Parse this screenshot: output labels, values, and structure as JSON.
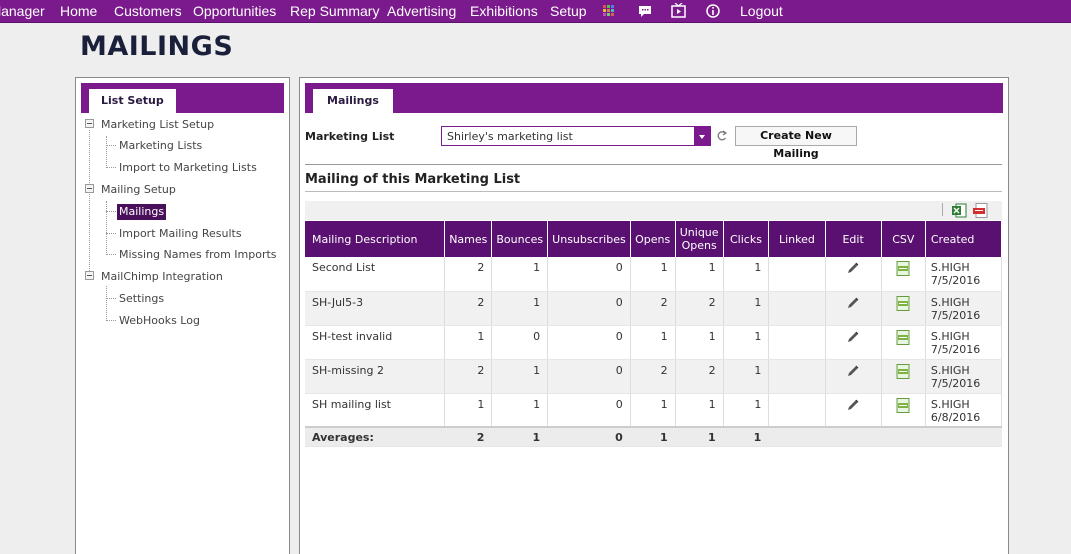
{
  "nav": {
    "items": [
      "lanager",
      "Home",
      "Customers",
      "Opportunities",
      "Rep Summary",
      "Advertising",
      "Exhibitions",
      "Setup"
    ],
    "logout": "Logout",
    "icons": [
      "apps-grid-icon",
      "chat-icon",
      "video-icon",
      "info-icon"
    ],
    "accent": "#7b1a8c"
  },
  "page_title": "MAILINGS",
  "left": {
    "tab": "List Setup",
    "tree": [
      {
        "label": "Marketing List Setup",
        "children": [
          "Marketing Lists",
          "Import to Marketing Lists"
        ]
      },
      {
        "label": "Mailing Setup",
        "children": [
          "Mailings",
          "Import Mailing Results",
          "Missing Names from Imports"
        ]
      },
      {
        "label": "MailChimp Integration",
        "children": [
          "Settings",
          "WebHooks Log"
        ]
      }
    ],
    "selected": "Mailings"
  },
  "right": {
    "tab": "Mailings",
    "list_label": "Marketing List",
    "list_value": "Shirley's marketing list",
    "create_button": "Create New Mailing",
    "section_title": "Mailing of this Marketing List",
    "columns": [
      "Mailing Description",
      "Names",
      "Bounces",
      "Unsubscribes",
      "Opens",
      "Unique Opens",
      "Clicks",
      "Linked",
      "Edit",
      "CSV",
      "Created"
    ],
    "rows": [
      {
        "description": "Second List",
        "names": "2",
        "bounces": "1",
        "unsubscribes": "0",
        "opens": "1",
        "unique_opens": "1",
        "clicks": "1",
        "linked": "",
        "created_by": "S.HIGH",
        "created_date": "7/5/2016"
      },
      {
        "description": "SH-Jul5-3",
        "names": "2",
        "bounces": "1",
        "unsubscribes": "0",
        "opens": "2",
        "unique_opens": "2",
        "clicks": "1",
        "linked": "",
        "created_by": "S.HIGH",
        "created_date": "7/5/2016"
      },
      {
        "description": "SH-test invalid",
        "names": "1",
        "bounces": "0",
        "unsubscribes": "0",
        "opens": "1",
        "unique_opens": "1",
        "clicks": "1",
        "linked": "",
        "created_by": "S.HIGH",
        "created_date": "7/5/2016"
      },
      {
        "description": "SH-missing 2",
        "names": "2",
        "bounces": "1",
        "unsubscribes": "0",
        "opens": "2",
        "unique_opens": "2",
        "clicks": "1",
        "linked": "",
        "created_by": "S.HIGH",
        "created_date": "7/5/2016"
      },
      {
        "description": "SH mailing list",
        "names": "1",
        "bounces": "1",
        "unsubscribes": "0",
        "opens": "1",
        "unique_opens": "1",
        "clicks": "1",
        "linked": "",
        "created_by": "S.HIGH",
        "created_date": "6/8/2016"
      }
    ],
    "averages": {
      "label": "Averages:",
      "names": "2",
      "bounces": "1",
      "unsubscribes": "0",
      "opens": "1",
      "unique_opens": "1",
      "clicks": "1"
    }
  }
}
